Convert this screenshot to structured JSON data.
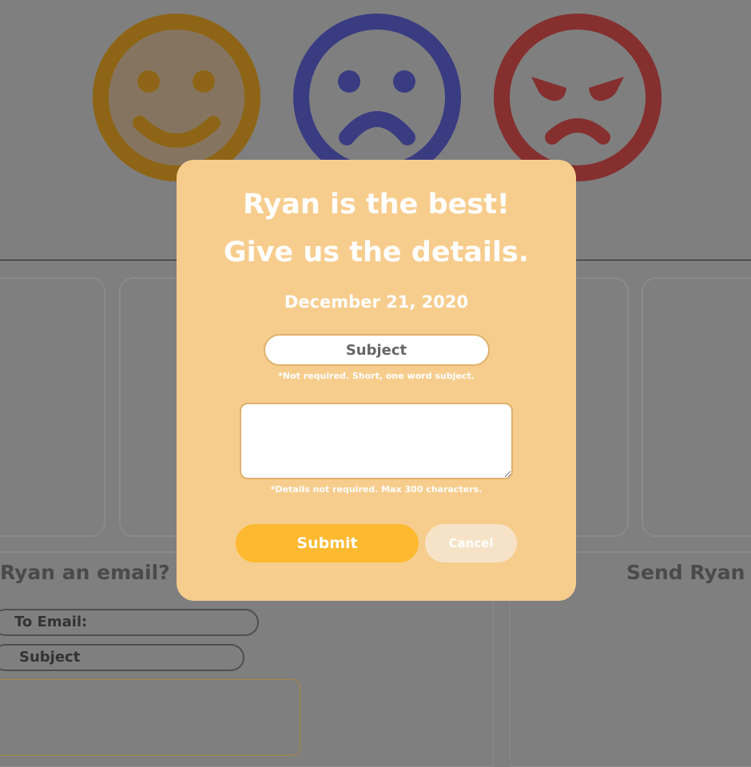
{
  "faces": {
    "happy_color": "#8e6516",
    "sad_color": "#3a3c82",
    "angry_color": "#852f2f"
  },
  "background": {
    "email_heading": "Ryan an email?",
    "right_heading": "Send Ryan lo",
    "to_email_label": "To Email:",
    "subject_label": "Subject"
  },
  "modal": {
    "title": "Ryan is the best! Give us the details.",
    "date": "December 21, 2020",
    "subject_placeholder": "Subject",
    "subject_hint": "*Not required. Short, one word subject.",
    "details_hint": "*Details not required. Max 300 characters.",
    "submit_label": "Submit",
    "cancel_label": "Cancel",
    "background_color": "#f7cd8e",
    "submit_color": "#fdb92f"
  }
}
